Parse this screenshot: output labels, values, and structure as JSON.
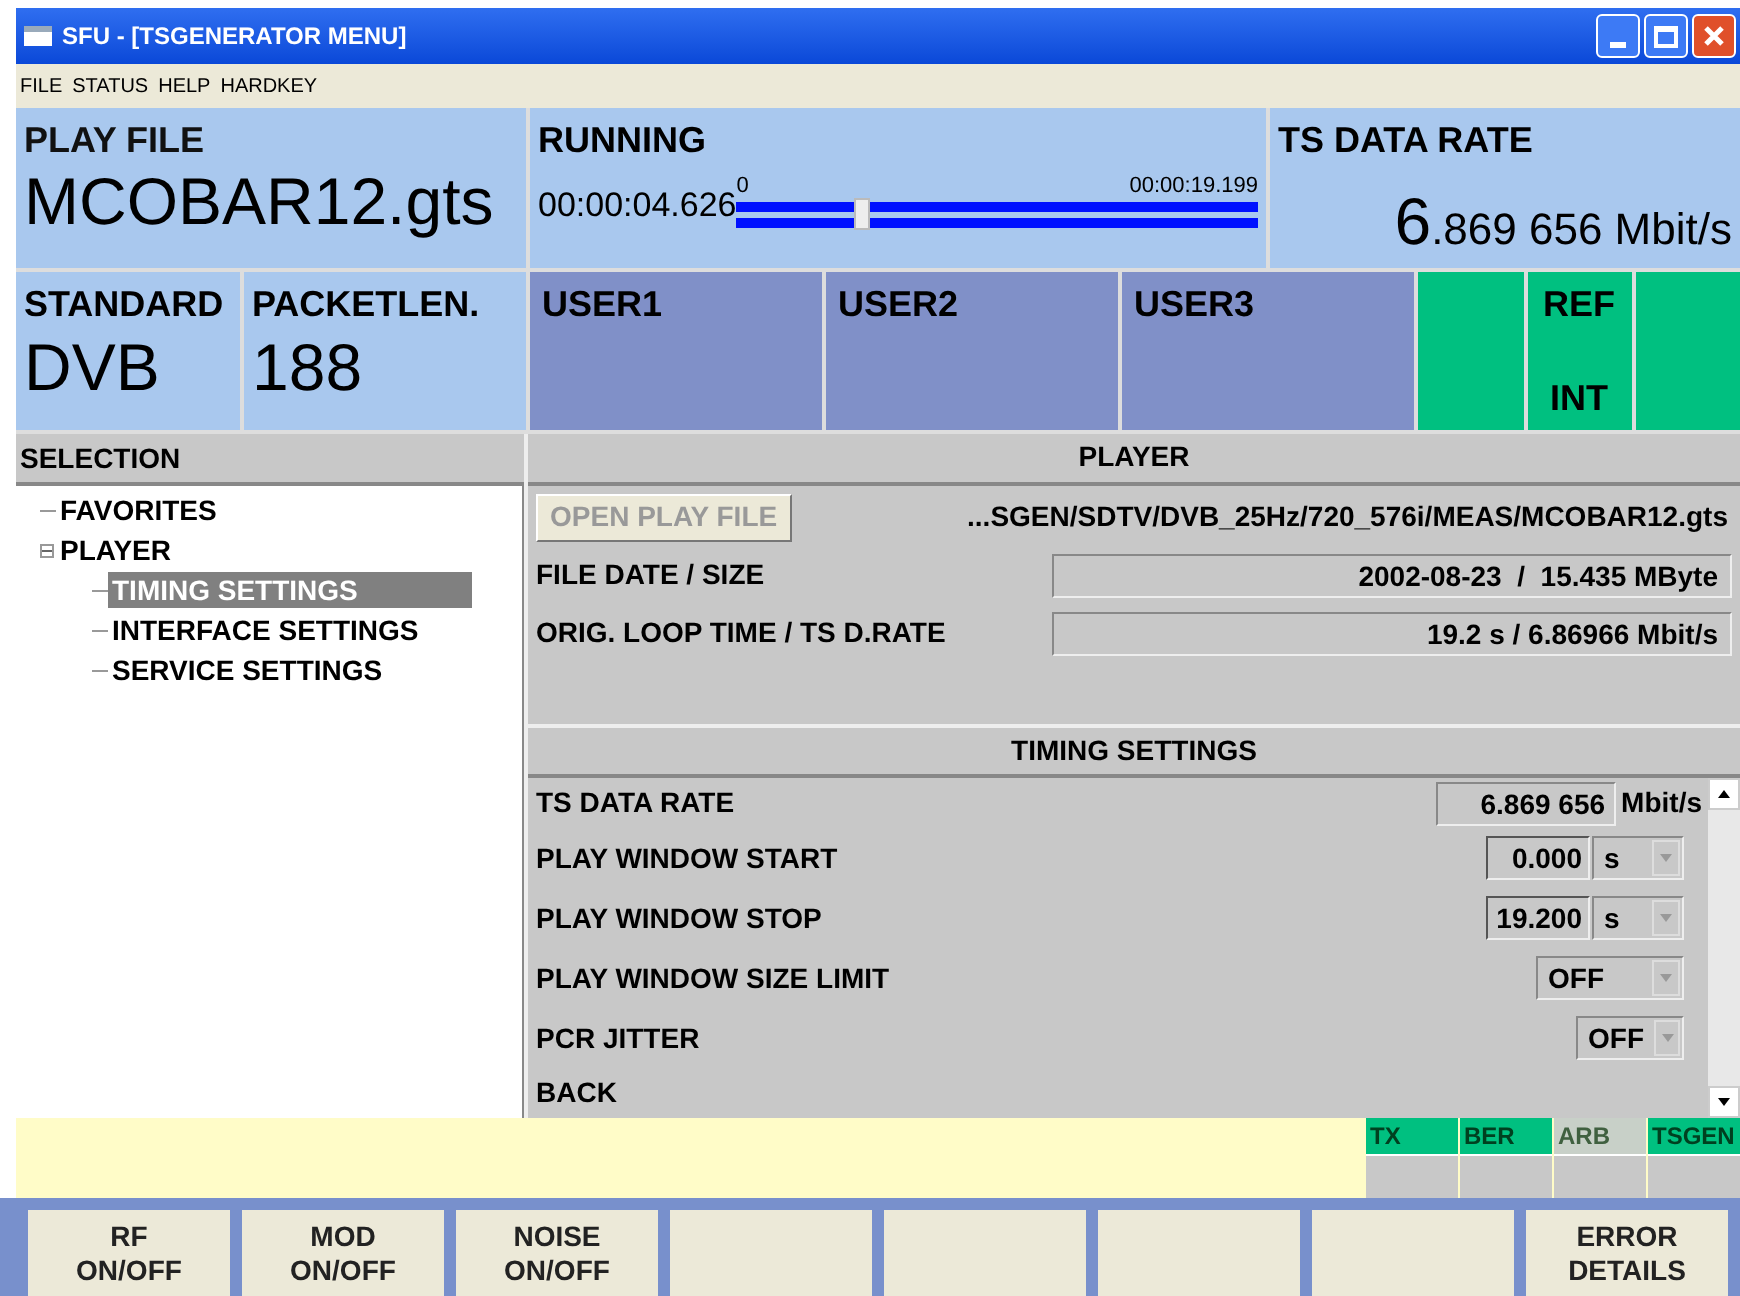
{
  "window": {
    "title": "SFU - [TSGENERATOR MENU]"
  },
  "menu": [
    "FILE",
    "STATUS",
    "HELP",
    "HARDKEY"
  ],
  "play_file": {
    "label": "PLAY FILE",
    "value": "MCOBAR12.gts"
  },
  "running": {
    "label": "RUNNING",
    "elapsed": "00:00:04.626",
    "start": "0",
    "end": "00:00:19.199",
    "level": 0.24
  },
  "ts_data_rate": {
    "label": "TS DATA RATE",
    "lead": "6",
    "value": ".869 656 Mbit/s"
  },
  "standard": {
    "label": "STANDARD",
    "value": "DVB"
  },
  "packet_length": {
    "label": "PACKETLEN.",
    "value": "188"
  },
  "user_keys": [
    "USER1",
    "USER2",
    "USER3"
  ],
  "status_cells": [
    {
      "kind": "lamp"
    },
    {
      "kind": "ref",
      "label": "REF",
      "value": "INT"
    },
    {
      "kind": "lamp"
    }
  ],
  "selection": {
    "title": "SELECTION",
    "tree": [
      {
        "label": "FAVORITES",
        "selected": false
      },
      {
        "label": "PLAYER",
        "selected": false,
        "expanded": true,
        "children": [
          {
            "label": "TIMING SETTINGS",
            "selected": true
          },
          {
            "label": "INTERFACE SETTINGS",
            "selected": false
          },
          {
            "label": "SERVICE SETTINGS",
            "selected": false
          }
        ]
      }
    ]
  },
  "player": {
    "title": "PLAYER",
    "open_button": "OPEN PLAY FILE",
    "path": "...SGEN/SDTV/DVB_25Hz/720_576i/MEAS/MCOBAR12.gts",
    "fields": [
      {
        "label": "FILE DATE / SIZE",
        "value": "2002-08-23  /  15.435 MByte"
      },
      {
        "label": "ORIG. LOOP TIME / TS D.RATE",
        "value": "19.2 s / 6.86966 Mbit/s"
      }
    ]
  },
  "timing": {
    "title": "TIMING SETTINGS",
    "rows": [
      {
        "kind": "readout",
        "label": "TS DATA RATE",
        "value": "6.869 656",
        "unit": "Mbit/s"
      },
      {
        "kind": "number",
        "label": "PLAY WINDOW START",
        "value": "0.000",
        "unit": "s"
      },
      {
        "kind": "number",
        "label": "PLAY WINDOW STOP",
        "value": "19.200",
        "unit": "s"
      },
      {
        "kind": "select",
        "label": "PLAY WINDOW SIZE LIMIT",
        "value": "OFF"
      },
      {
        "kind": "select_small",
        "label": "PCR JITTER",
        "value": "OFF"
      },
      {
        "kind": "link",
        "label": "BACK"
      }
    ]
  },
  "indicators": [
    {
      "label": "TX",
      "on": true
    },
    {
      "label": "BER",
      "on": true
    },
    {
      "label": "ARB",
      "on": false
    },
    {
      "label": "TSGEN",
      "on": true
    }
  ],
  "softkeys": [
    {
      "kind": "labeled",
      "lines": [
        "RF",
        "ON/OFF"
      ]
    },
    {
      "kind": "labeled",
      "lines": [
        "MOD",
        "ON/OFF"
      ]
    },
    {
      "kind": "labeled",
      "lines": [
        "NOISE",
        "ON/OFF"
      ]
    },
    {
      "kind": "blank"
    },
    {
      "kind": "blank"
    },
    {
      "kind": "blank"
    },
    {
      "kind": "blank"
    },
    {
      "kind": "labeled",
      "lines": [
        "ERROR",
        "DETAILS"
      ]
    }
  ]
}
